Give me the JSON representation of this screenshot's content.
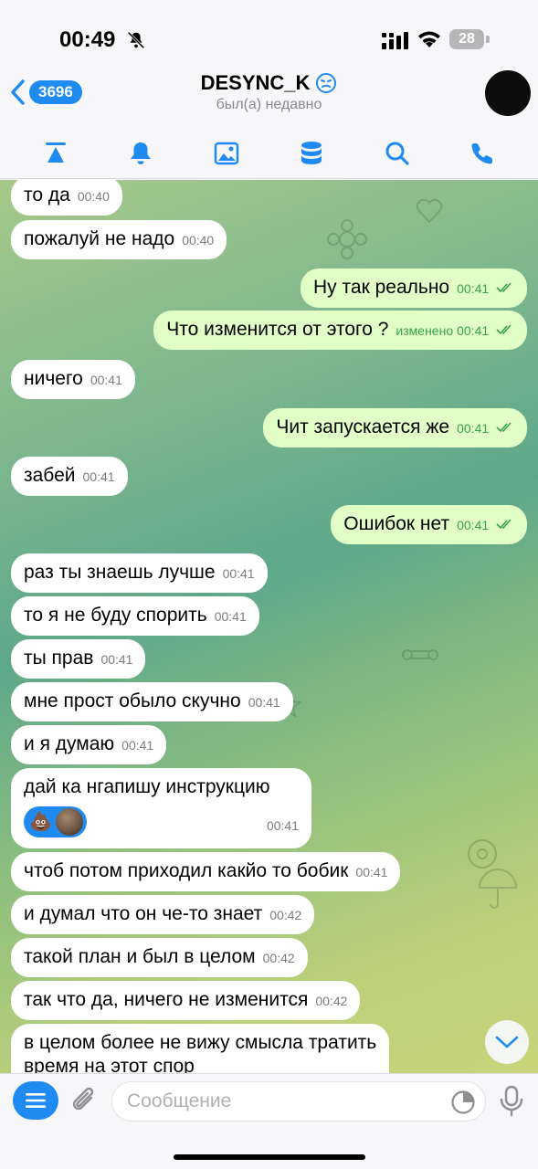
{
  "status_bar": {
    "time": "00:49",
    "battery": "28"
  },
  "header": {
    "back_count": "3696",
    "title": "DESYNC_K",
    "subtitle": "был(а) недавно"
  },
  "toolbar": {
    "icons": [
      "pin-icon",
      "bell-icon",
      "gallery-icon",
      "storage-icon",
      "search-icon",
      "phone-icon"
    ]
  },
  "colors": {
    "accent": "#1f8bf0",
    "outgoing_bubble": "#e1fec6",
    "incoming_bubble": "#ffffff",
    "read_check": "#3aa346"
  },
  "messages": [
    {
      "dir": "in",
      "text": "то да",
      "time": "00:40"
    },
    {
      "dir": "in",
      "text": "пожалуй не надо",
      "time": "00:40"
    },
    {
      "dir": "out",
      "text": "Ну так реально",
      "time": "00:41"
    },
    {
      "dir": "out",
      "text": "Что изменится от этого ?",
      "time": "00:41",
      "edited": "изменено"
    },
    {
      "dir": "in",
      "text": "ничего",
      "time": "00:41"
    },
    {
      "dir": "out",
      "text": "Чит запускается же",
      "time": "00:41"
    },
    {
      "dir": "in",
      "text": "забей",
      "time": "00:41"
    },
    {
      "dir": "out",
      "text": "Ошибок нет",
      "time": "00:41"
    },
    {
      "dir": "in",
      "text": "раз ты знаешь лучше",
      "time": "00:41"
    },
    {
      "dir": "in",
      "text": "то я не буду спорить",
      "time": "00:41"
    },
    {
      "dir": "in",
      "text": "ты прав",
      "time": "00:41"
    },
    {
      "dir": "in",
      "text": "мне прост обыло скучно",
      "time": "00:41"
    },
    {
      "dir": "in",
      "text": "и я думаю",
      "time": "00:41"
    },
    {
      "dir": "in",
      "text": "дай ка нгапишу инструкцию",
      "time": "00:41",
      "reaction": "💩"
    },
    {
      "dir": "in",
      "text": "чтоб потом приходил какйо то бобик",
      "time": "00:41"
    },
    {
      "dir": "in",
      "text": "и думал что он че-то знает",
      "time": "00:42"
    },
    {
      "dir": "in",
      "text": "такой план и был в целом",
      "time": "00:42"
    },
    {
      "dir": "in",
      "text": "так что да, ничего не изменится",
      "time": "00:42"
    },
    {
      "dir": "in",
      "text": "в целом более не вижу смысла тратить",
      "text2": "время на этот спор"
    }
  ],
  "input": {
    "placeholder": "Сообщение"
  }
}
